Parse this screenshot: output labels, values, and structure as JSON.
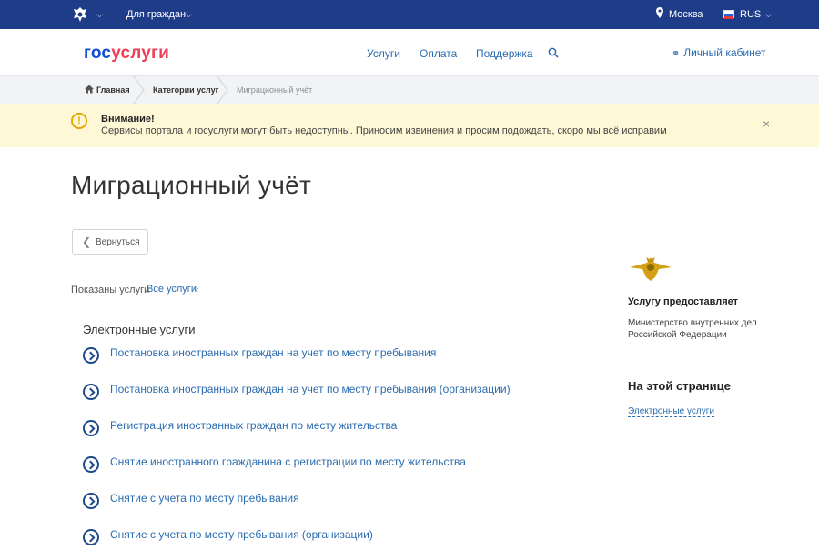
{
  "topbar": {
    "citizens_label": "Для граждан",
    "city": "Москва",
    "language": "RUS",
    "bg_color": "#1f3c88"
  },
  "header": {
    "logo_part1": "гос",
    "logo_part2": "услуги",
    "nav": [
      "Услуги",
      "Оплата",
      "Поддержка"
    ],
    "cabinet_label": "Личный кабинет",
    "accent_color": "#2b6cb0"
  },
  "breadcrumbs": [
    "Главная",
    "Категории услуг",
    "Миграционный учёт"
  ],
  "alert": {
    "title": "Внимание!",
    "message": "Сервисы портала и госуслуги могут быть недоступны. Приносим извинения и просим подождать, скоро мы всё исправим",
    "close": "×",
    "bg_color": "#fff8d6"
  },
  "page": {
    "title": "Миграционный учёт",
    "back_label": "Вернуться",
    "filter_label": "Показаны услуги",
    "filter_value": "Все услуги"
  },
  "services": {
    "section_title": "Электронные услуги",
    "items": [
      "Постановка иностранных граждан на учет по месту пребывания",
      "Постановка иностранных граждан на учет по месту пребывания (организации)",
      "Регистрация иностранных граждан по месту жительства",
      "Снятие иностранного гражданина с регистрации по месту жительства",
      "Снятие с учета по месту пребывания",
      "Снятие с учета по месту пребывания (организации)"
    ]
  },
  "sidebar": {
    "provider_heading": "Услугу предоставляет",
    "provider_line1": "Министерство внутренних дел",
    "provider_line2": "Российской Федерации",
    "on_page_heading": "На этой странице",
    "on_page_link": "Электронные услуги"
  }
}
